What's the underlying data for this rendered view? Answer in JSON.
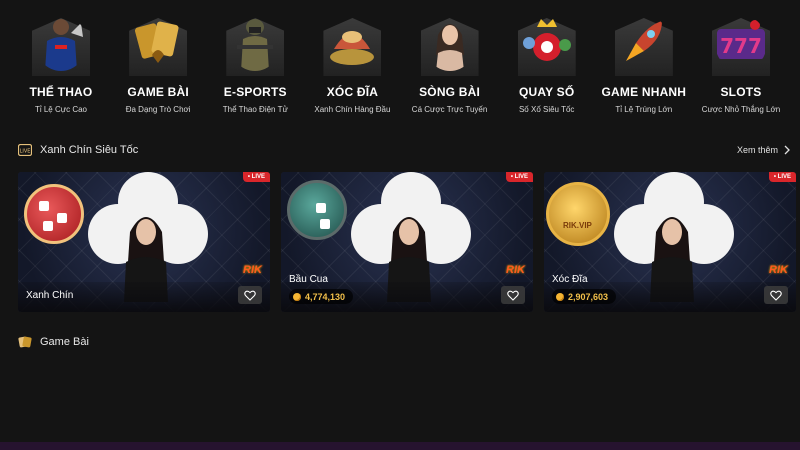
{
  "categories": [
    {
      "label": "THỂ THAO",
      "sub": "Tỉ Lệ Cực Cao",
      "icon": "soccer-player-icon",
      "color": "#1b3a8c"
    },
    {
      "label": "GAME BÀI",
      "sub": "Đa Dạng Trò Chơi",
      "icon": "playing-cards-icon",
      "color": "#c9962c"
    },
    {
      "label": "E-SPORTS",
      "sub": "Thể Thao Điện Tử",
      "icon": "esports-soldier-icon",
      "color": "#6f6a44"
    },
    {
      "label": "XÓC ĐĨA",
      "sub": "Xanh Chín Hàng Đầu",
      "icon": "xoc-dia-bowl-icon",
      "color": "#c9563a"
    },
    {
      "label": "SÒNG BÀI",
      "sub": "Cá Cược Trực Tuyến",
      "icon": "casino-dealer-icon",
      "color": "#d9b9a3"
    },
    {
      "label": "QUAY SỐ",
      "sub": "Số Xố Siêu Tốc",
      "icon": "lottery-balls-icon",
      "color": "#d41f2c"
    },
    {
      "label": "GAME NHANH",
      "sub": "Tỉ Lệ Trúng Lớn",
      "icon": "rocket-icon",
      "color": "#c8442e"
    },
    {
      "label": "SLOTS",
      "sub": "Cược Nhỏ Thắng Lớn",
      "icon": "slot-777-icon",
      "color": "#e23a8a"
    }
  ],
  "section1": {
    "title": "Xanh Chín Siêu Tốc",
    "see_more": "Xem thêm"
  },
  "cards": [
    {
      "name": "Xanh Chín",
      "live": "• LIVE",
      "brand": "RIK"
    },
    {
      "name": "Bầu Cua",
      "jackpot": "4,774,130",
      "live": "• LIVE",
      "brand": "RIK"
    },
    {
      "name": "Xóc Đĩa",
      "jackpot": "2,907,603",
      "live": "• LIVE",
      "brand": "RIK",
      "disc_text": "RIK.VIP"
    }
  ],
  "section2": {
    "title": "Game Bài"
  },
  "colors": {
    "background": "#141414",
    "live": "#d9262b",
    "gold": "#f2c04a",
    "footer": "#26132f"
  }
}
